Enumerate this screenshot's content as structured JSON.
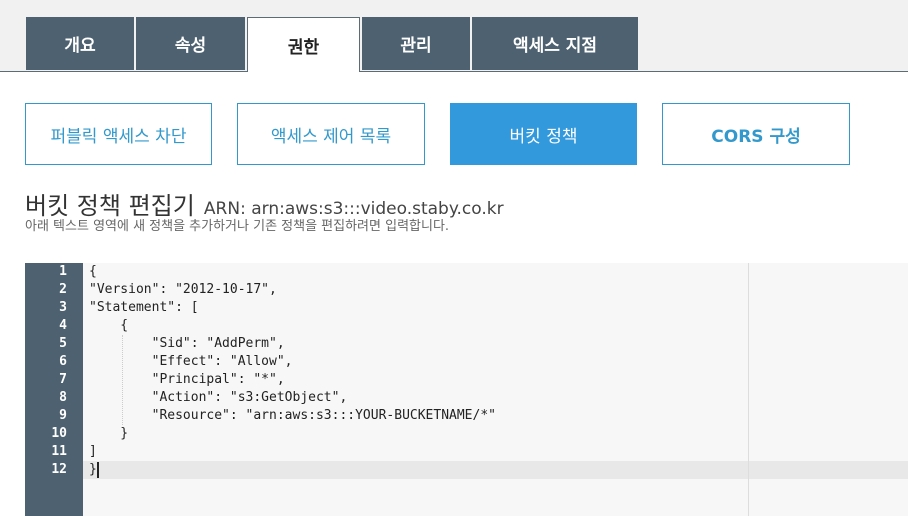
{
  "tabs": [
    {
      "label": "개요"
    },
    {
      "label": "속성"
    },
    {
      "label": "권한",
      "active": true
    },
    {
      "label": "관리"
    },
    {
      "label": "액세스 지점"
    }
  ],
  "subnav": [
    {
      "label": "퍼블릭 액세스 차단"
    },
    {
      "label": "액세스 제어 목록"
    },
    {
      "label": "버킷 정책",
      "active": true
    },
    {
      "label": "CORS 구성"
    }
  ],
  "editor_header": {
    "title": "버킷 정책 편집기",
    "arn": "ARN: arn:aws:s3:::video.staby.co.kr",
    "description": "아래 텍스트 영역에 새 정책을 추가하거나 기존 정책을 편집하려면 입력합니다."
  },
  "editor": {
    "line_numbers": [
      "1",
      "2",
      "3",
      "4",
      "5",
      "6",
      "7",
      "8",
      "9",
      "10",
      "11",
      "12"
    ],
    "lines": [
      "{",
      "\"Version\": \"2012-10-17\",",
      "\"Statement\": [",
      "    {",
      "        \"Sid\": \"AddPerm\",",
      "        \"Effect\": \"Allow\",",
      "        \"Principal\": \"*\",",
      "        \"Action\": \"s3:GetObject\",",
      "        \"Resource\": \"arn:aws:s3:::YOUR-BUCKETNAME/*\"",
      "    }",
      "]",
      "}"
    ],
    "active_line": 12
  },
  "colors": {
    "tab_bg": "#4d6170",
    "accent": "#3399dd"
  }
}
